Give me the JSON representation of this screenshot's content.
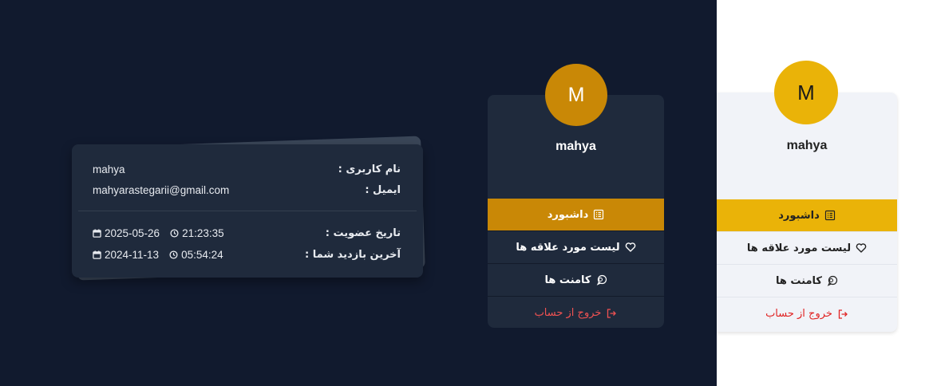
{
  "colors": {
    "dark_bg": "#111a2e",
    "card_dark": "#1f2a3c",
    "accent_dark": "#c98806",
    "accent_light": "#eab308",
    "logout": "#f05252"
  },
  "info_card": {
    "username_label": "نام کاربری :",
    "username_value": "mahya",
    "email_label": "ایمیل :",
    "email_value": "mahyarastegarii@gmail.com",
    "joined_label": "تاریخ عضویت :",
    "joined_date": "2025-05-26",
    "joined_time": "21:23:35",
    "last_visit_label": "آخرین بازدید شما :",
    "last_visit_date": "2024-11-13",
    "last_visit_time": "05:54:24"
  },
  "profile_dark": {
    "avatar_letter": "M",
    "username": "mahya",
    "menu": [
      {
        "label": "داشبورد",
        "icon": "dashboard-icon",
        "active": true
      },
      {
        "label": "لیست مورد علاقه ها",
        "icon": "heart-icon"
      },
      {
        "label": "کامنت ها",
        "icon": "comments-icon"
      },
      {
        "label": "خروج از حساب",
        "icon": "logout-icon"
      }
    ]
  },
  "profile_light": {
    "avatar_letter": "M",
    "username": "mahya",
    "menu": [
      {
        "label": "داشبورد",
        "icon": "dashboard-icon",
        "active": true
      },
      {
        "label": "لیست مورد علاقه ها",
        "icon": "heart-icon"
      },
      {
        "label": "کامنت ها",
        "icon": "comments-icon"
      },
      {
        "label": "خروج از حساب",
        "icon": "logout-icon"
      }
    ]
  }
}
